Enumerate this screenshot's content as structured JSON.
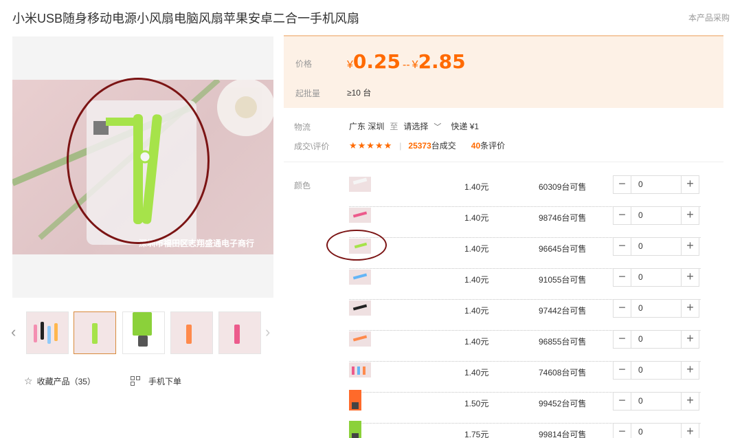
{
  "product": {
    "title": "小米USB随身移动电源小风扇电脑风扇苹果安卓二合一手机风扇",
    "side_note": "本产品采购"
  },
  "gallery": {
    "main_image_watermark": "深圳市福田区志翔盛通电子商行",
    "thumbnails": [
      "colorful-fans-thumb",
      "green-fan-thumb",
      "green-usb-thumb",
      "orange-fan-thumb",
      "pink-fan-thumb"
    ],
    "active_thumbnail": 1
  },
  "actions": {
    "favorite_label": "收藏产品（35）",
    "mobile_order_label": "手机下单"
  },
  "pricing": {
    "price_label": "价格",
    "currency": "¥",
    "price_min": "0.25",
    "range_sep": "--",
    "price_max": "2.85",
    "moq_label": "起批量",
    "moq_value": "≥10 台"
  },
  "logistics": {
    "label": "物流",
    "from": "广东 深圳",
    "to_word": "至",
    "destination": "请选择",
    "shipping": "快递 ¥1"
  },
  "reviews": {
    "label": "成交\\评价",
    "stars": "★★★★★",
    "sold_count": "25373",
    "sold_suffix": "台成交",
    "review_count": "40",
    "review_suffix": "条评价"
  },
  "variants": {
    "label": "颜色",
    "rows": [
      {
        "image": "white-fan-variant",
        "price": "1.40元",
        "stock": "60309台可售",
        "qty": "0"
      },
      {
        "image": "pink-fan-variant",
        "price": "1.40元",
        "stock": "98746台可售",
        "qty": "0"
      },
      {
        "image": "green-fan-variant",
        "price": "1.40元",
        "stock": "96645台可售",
        "qty": "0"
      },
      {
        "image": "blue-fan-variant",
        "price": "1.40元",
        "stock": "91055台可售",
        "qty": "0"
      },
      {
        "image": "black-fan-variant",
        "price": "1.40元",
        "stock": "97442台可售",
        "qty": "0"
      },
      {
        "image": "orange-fan-variant",
        "price": "1.40元",
        "stock": "96855台可售",
        "qty": "0"
      },
      {
        "image": "mixed-fan-variant",
        "price": "1.40元",
        "stock": "74608台可售",
        "qty": "0"
      },
      {
        "image": "orange-usb-variant",
        "price": "1.50元",
        "stock": "99452台可售",
        "qty": "0"
      },
      {
        "image": "green-usb-variant",
        "price": "1.75元",
        "stock": "99814台可售",
        "qty": "0"
      }
    ]
  },
  "colors": {
    "accent": "#ff6a00",
    "annotation": "#7b1414",
    "price_bg": "#fdf1e6"
  }
}
